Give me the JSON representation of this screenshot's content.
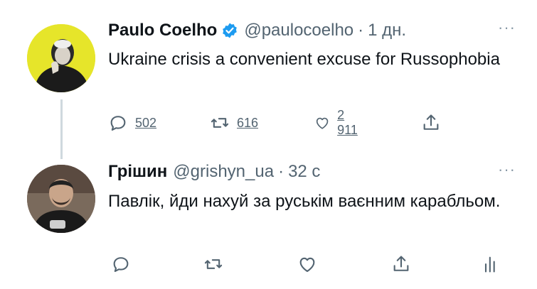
{
  "tweet1": {
    "name": "Paulo Coelho",
    "handle": "@paulocoelho",
    "dot": "·",
    "time": "1 дн.",
    "more": "···",
    "text": "Ukraine crisis a convenient excuse for Russophobia",
    "replies": "502",
    "retweets": "616",
    "likes": "2 911"
  },
  "tweet2": {
    "name": "Грішин",
    "handle": "@grishyn_ua",
    "dot": "·",
    "time": "32 с",
    "more": "···",
    "text": "Павлік, йди нахуй за руськім ваєнним карабльом."
  },
  "icons": [
    "verified-badge-icon",
    "reply-icon",
    "retweet-icon",
    "like-icon",
    "share-icon",
    "analytics-icon"
  ],
  "colors": {
    "verified": "#1d9bf0",
    "secondary_text": "#536471",
    "thread_line": "#cfd9de",
    "avatar1_bg": "#e6e52a"
  }
}
